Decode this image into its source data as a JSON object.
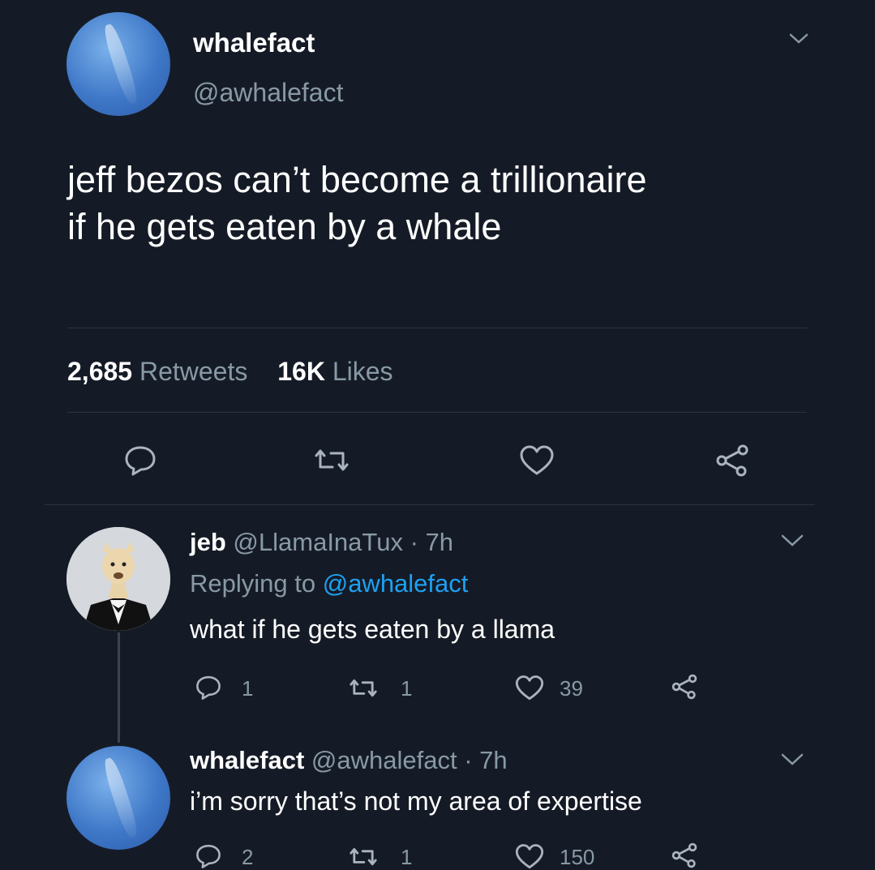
{
  "main_tweet": {
    "display_name": "whalefact",
    "handle": "@awhalefact",
    "text_line1": "jeff bezos can’t become a trillionaire",
    "text_line2": "if he gets eaten by a whale",
    "retweet_count": "2,685",
    "retweet_label": "Retweets",
    "like_count": "16K",
    "like_label": "Likes"
  },
  "reply1": {
    "display_name": "jeb",
    "handle": "@LlamaInaTux",
    "time": "· 7h",
    "replying_label": "Replying to",
    "replying_handle": "@awhalefact",
    "text": "what if he gets eaten by a llama",
    "reply_count": "1",
    "retweet_count": "1",
    "like_count": "39"
  },
  "reply2": {
    "display_name": "whalefact",
    "handle": "@awhalefact",
    "time": "· 7h",
    "text": "i’m sorry that’s not my area of expertise",
    "reply_count": "2",
    "retweet_count": "1",
    "like_count": "150"
  },
  "colors": {
    "background": "#151b26",
    "link": "#1da1f2",
    "muted": "#8899a6"
  },
  "icons": [
    "chevron-down-icon",
    "reply-icon",
    "retweet-icon",
    "like-icon",
    "share-icon"
  ]
}
